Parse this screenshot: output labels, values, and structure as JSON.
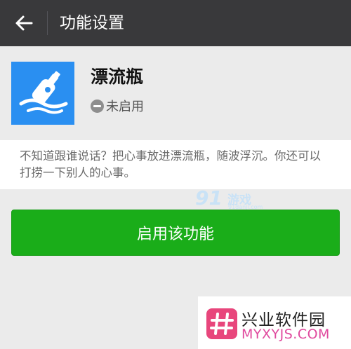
{
  "header": {
    "title": "功能设置",
    "back_icon": "arrow-left-icon"
  },
  "feature": {
    "name": "漂流瓶",
    "status": "未启用",
    "status_icon": "minus-circle-icon",
    "icon": "bottle-icon",
    "icon_color": "#2a8ff1"
  },
  "description": "不知道跟谁说话？把心事放进漂流瓶，随波浮沉。你还可以打捞一下别人的心事。",
  "actions": {
    "enable_label": "启用该功能",
    "enable_color": "#1aad19"
  },
  "watermarks": {
    "game_logo": "91",
    "game_logo_sub": "游戏",
    "game_logo_domain": "91danji.com",
    "site_name": "兴业软件园",
    "site_url": "MYXYJS.COM",
    "site_logo_icon": "hash-icon"
  }
}
